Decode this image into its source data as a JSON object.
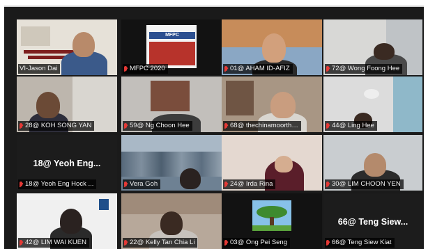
{
  "tiles": [
    {
      "name": "VI-Jason Dai",
      "center_name": ""
    },
    {
      "name": "MFPC 2020",
      "center_name": ""
    },
    {
      "name": "01@ AHAM ID-AFIZ",
      "center_name": ""
    },
    {
      "name": "72@ Wong Foong Hee",
      "center_name": ""
    },
    {
      "name": "28@ KOH SONG YAN",
      "center_name": ""
    },
    {
      "name": "59@ Ng Choon Hee",
      "center_name": ""
    },
    {
      "name": "68@ thechinamoorth…",
      "center_name": ""
    },
    {
      "name": "44@ Ling Hee",
      "center_name": ""
    },
    {
      "name": "18@ Yeoh Eng Hock ...",
      "center_name": "18@ Yeoh Eng..."
    },
    {
      "name": "Vera Goh",
      "center_name": ""
    },
    {
      "name": "24@ Irda Rina",
      "center_name": ""
    },
    {
      "name": "30@ LIM CHOON YEN",
      "center_name": ""
    },
    {
      "name": "42@ LIM WAI KUEN",
      "center_name": ""
    },
    {
      "name": "22@ Kelly Tan Chia Li",
      "center_name": ""
    },
    {
      "name": "03@ Ong Pei Seng",
      "center_name": ""
    },
    {
      "name": "66@ Teng Siew Kiat",
      "center_name": "66@ Teng Siew..."
    }
  ],
  "slide_logo_text": "MFPC",
  "colors": {
    "active_border": "#c8e64a",
    "mute": "#e53935",
    "background": "#1a1a1a"
  }
}
